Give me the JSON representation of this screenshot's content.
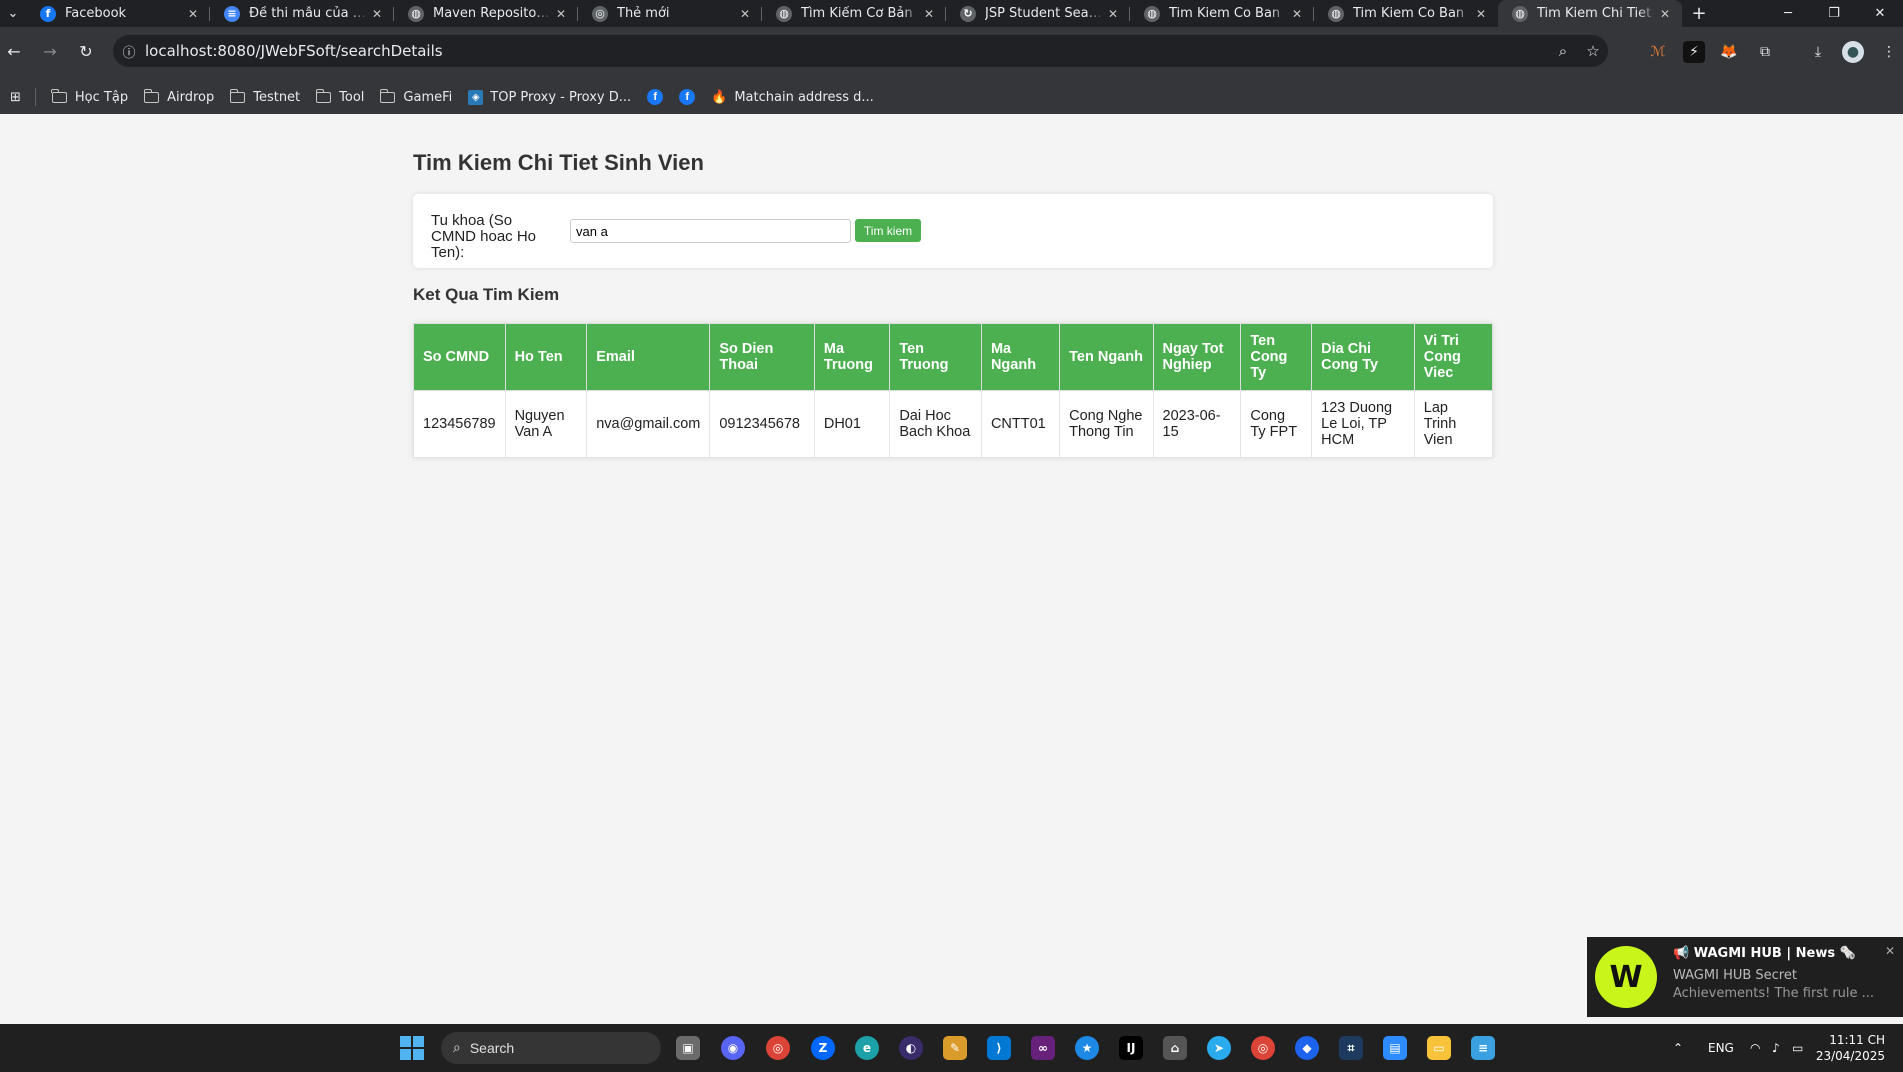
{
  "browser": {
    "tabs": [
      {
        "title": "Facebook",
        "icon": "facebook-icon",
        "color": "#1877f2",
        "glyph": "f"
      },
      {
        "title": "Đề thi mẫu của Camp",
        "icon": "document-icon",
        "color": "#4285f4",
        "glyph": "≡"
      },
      {
        "title": "Maven Repository: m",
        "icon": "globe-icon",
        "color": "#5f6368",
        "glyph": "◍"
      },
      {
        "title": "Thẻ mới",
        "icon": "chrome-icon",
        "color": "#5f6368",
        "glyph": "◎"
      },
      {
        "title": "Tìm Kiếm Cơ Bản",
        "icon": "globe-icon",
        "color": "#5f6368",
        "glyph": "◍"
      },
      {
        "title": "JSP Student Search R",
        "icon": "reload-icon",
        "color": "#5f6368",
        "glyph": "↻"
      },
      {
        "title": "Tim Kiem Co Ban",
        "icon": "globe-icon",
        "color": "#5f6368",
        "glyph": "◍"
      },
      {
        "title": "Tim Kiem Co Ban",
        "icon": "globe-icon",
        "color": "#5f6368",
        "glyph": "◍"
      },
      {
        "title": "Tim Kiem Chi Tiet",
        "icon": "globe-icon",
        "color": "#5f6368",
        "glyph": "◍"
      }
    ],
    "url": "localhost:8080/JWebFSoft/searchDetails",
    "bookmarks": [
      {
        "label": "Học Tập",
        "type": "folder"
      },
      {
        "label": "Airdrop",
        "type": "folder"
      },
      {
        "label": "Testnet",
        "type": "folder"
      },
      {
        "label": "Tool",
        "type": "folder"
      },
      {
        "label": "GameFi",
        "type": "folder"
      }
    ],
    "bookmark_proxy": "TOP Proxy - Proxy D...",
    "bookmark_matchain": "Matchain address d..."
  },
  "page": {
    "title": "Tim Kiem Chi Tiet Sinh Vien",
    "search_label": "Tu khoa (So CMND hoac Ho Ten):",
    "search_value": "van a",
    "search_button": "Tim kiem",
    "results_title": "Ket Qua Tim Kiem",
    "table": {
      "headers": [
        "So CMND",
        "Ho Ten",
        "Email",
        "So Dien Thoai",
        "Ma Truong",
        "Ten Truong",
        "Ma Nganh",
        "Ten Nganh",
        "Ngay Tot Nghiep",
        "Ten Cong Ty",
        "Dia Chi Cong Ty",
        "Vi Tri Cong Viec"
      ],
      "rows": [
        [
          "123456789",
          "Nguyen Van A",
          "nva@gmail.com",
          "0912345678",
          "DH01",
          "Dai Hoc Bach Khoa",
          "CNTT01",
          "Cong Nghe Thong Tin",
          "2023-06-15",
          "Cong Ty FPT",
          "123 Duong Le Loi, TP HCM",
          "Lap Trinh Vien"
        ]
      ]
    },
    "accent_color": "#4caf50"
  },
  "notification": {
    "title": "📢 WAGMI HUB | News 🗞️",
    "line1": "WAGMI HUB Secret",
    "line2": "Achievements!  The first rule ..."
  },
  "taskbar": {
    "search_placeholder": "Search",
    "lang": "ENG",
    "time": "11:11 CH",
    "date": "23/04/2025"
  }
}
